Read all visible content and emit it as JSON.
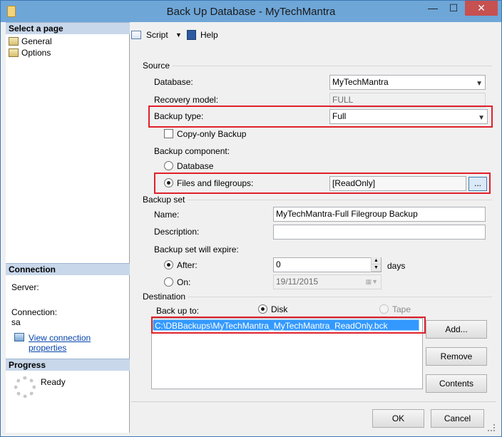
{
  "window": {
    "title": "Back Up Database - MyTechMantra",
    "minimize": "—",
    "maximize": "☐",
    "close": "✕"
  },
  "left_pane": {
    "select_page_header": "Select a page",
    "pages": [
      {
        "label": "General"
      },
      {
        "label": "Options"
      }
    ],
    "connection_header": "Connection",
    "server_label": "Server:",
    "server_value": "",
    "connection_label": "Connection:",
    "connection_value": "sa",
    "view_connection_link": "View connection properties",
    "progress_header": "Progress",
    "progress_status": "Ready"
  },
  "toolbar": {
    "script_label": "Script",
    "help_label": "Help"
  },
  "source": {
    "section_label": "Source",
    "database_label": "Database:",
    "database_value": "MyTechMantra",
    "recovery_model_label": "Recovery model:",
    "recovery_model_value": "FULL",
    "backup_type_label": "Backup type:",
    "backup_type_value": "Full",
    "copy_only_label": "Copy-only Backup",
    "copy_only_checked": false,
    "backup_component_label": "Backup component:",
    "component_database_label": "Database",
    "component_files_label": "Files and filegroups:",
    "component_selected": "Files and filegroups",
    "filegroups_value": "[ReadOnly]",
    "browse_button": "..."
  },
  "backup_set": {
    "section_label": "Backup set",
    "name_label": "Name:",
    "name_value": "MyTechMantra-Full Filegroup Backup",
    "description_label": "Description:",
    "description_value": "",
    "expire_label": "Backup set will expire:",
    "after_label": "After:",
    "after_value": "0",
    "days_label": "days",
    "on_label": "On:",
    "on_value": "19/11/2015",
    "expire_selected": "After"
  },
  "destination": {
    "section_label": "Destination",
    "back_up_to_label": "Back up to:",
    "disk_label": "Disk",
    "tape_label": "Tape",
    "selected": "Disk",
    "paths": [
      "C:\\DBBackups\\MyTechMantra_MyTechMantra_ReadOnly.bck"
    ],
    "add_button": "Add...",
    "remove_button": "Remove",
    "contents_button": "Contents"
  },
  "footer": {
    "ok_button": "OK",
    "cancel_button": "Cancel"
  },
  "colors": {
    "title_bar": "#6ea6d8",
    "highlight_box": "#e0202a",
    "selection": "#3399ff",
    "link": "#0645ad"
  }
}
